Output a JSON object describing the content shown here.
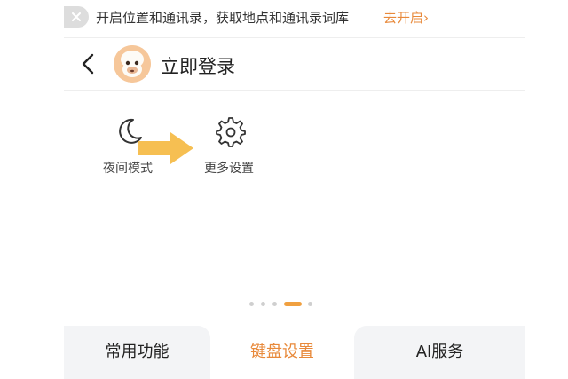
{
  "banner": {
    "icon": "toggle-off-icon",
    "text": "开启位置和通讯录，获取地点和通讯录词库",
    "link_label": "去开启",
    "link_arrow": "›"
  },
  "header": {
    "back_icon": "chevron-left-icon",
    "avatar_icon": "monkey-avatar-icon",
    "login_label": "立即登录"
  },
  "functions": [
    {
      "icon": "moon-icon",
      "label": "夜间模式"
    },
    {
      "icon": "gear-icon",
      "label": "更多设置"
    }
  ],
  "pager": {
    "count": 5,
    "active_index": 3
  },
  "tabs": [
    {
      "label": "常用功能",
      "selected": false
    },
    {
      "label": "键盘设置",
      "selected": true
    },
    {
      "label": "AI服务",
      "selected": false
    }
  ],
  "colors": {
    "accent": "#e8893a",
    "annotation_arrow": "#f6bf52",
    "tab_background": "#f3f4f6",
    "avatar_background": "#f6c79a"
  }
}
